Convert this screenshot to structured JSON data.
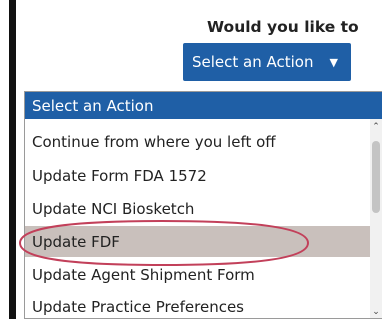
{
  "prompt": {
    "text": "Would you like to"
  },
  "action_select": {
    "selected_label": "Select an Action",
    "caret_icon": "caret-down-icon"
  },
  "dropdown": {
    "header_label": "Select an Action",
    "options": [
      {
        "label": "Continue from where you left off"
      },
      {
        "label": "Update Form FDA 1572"
      },
      {
        "label": "Update NCI Biosketch"
      },
      {
        "label": "Update FDF"
      },
      {
        "label": "Update Agent Shipment Form"
      },
      {
        "label": "Update Practice Preferences"
      }
    ],
    "hovered_option": "Update FDF"
  },
  "colors": {
    "accent_blue": "#1f5fa6",
    "hover_gray": "#c9c0bc",
    "annotation_red": "#c2405a"
  }
}
